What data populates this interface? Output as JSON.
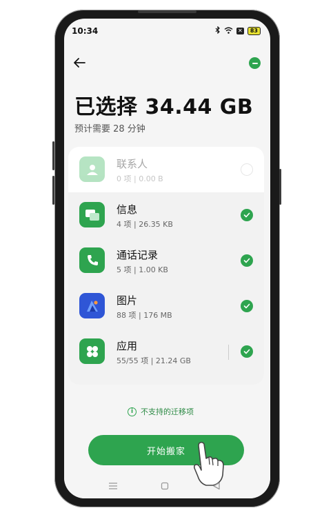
{
  "status_bar": {
    "time": "10:34",
    "battery": "83",
    "icons": [
      "bluetooth-icon",
      "wifi-icon",
      "x-badge-icon",
      "battery-icon"
    ]
  },
  "header": {
    "title": "已选择 34.44  GB",
    "subtitle": "预计需要 28 分钟"
  },
  "items": [
    {
      "name": "联系人",
      "meta": "0 项 | 0.00  B",
      "icon": "contacts-icon",
      "checked": false,
      "disabled": true
    },
    {
      "name": "信息",
      "meta": "4 项 | 26.35  KB",
      "icon": "messages-icon",
      "checked": true,
      "disabled": false
    },
    {
      "name": "通话记录",
      "meta": "5 项 | 1.00  KB",
      "icon": "phone-icon",
      "checked": true,
      "disabled": false
    },
    {
      "name": "图片",
      "meta": "88 项 | 176  MB",
      "icon": "gallery-icon",
      "checked": true,
      "disabled": false
    },
    {
      "name": "应用",
      "meta": "55/55 项 | 21.24  GB",
      "icon": "apps-icon",
      "checked": true,
      "disabled": false
    }
  ],
  "footer": {
    "unsupported_label": "不支持的迁移项",
    "start_button": "开始搬家"
  },
  "colors": {
    "accent": "#2ea44f",
    "background": "#f5f5f5"
  }
}
